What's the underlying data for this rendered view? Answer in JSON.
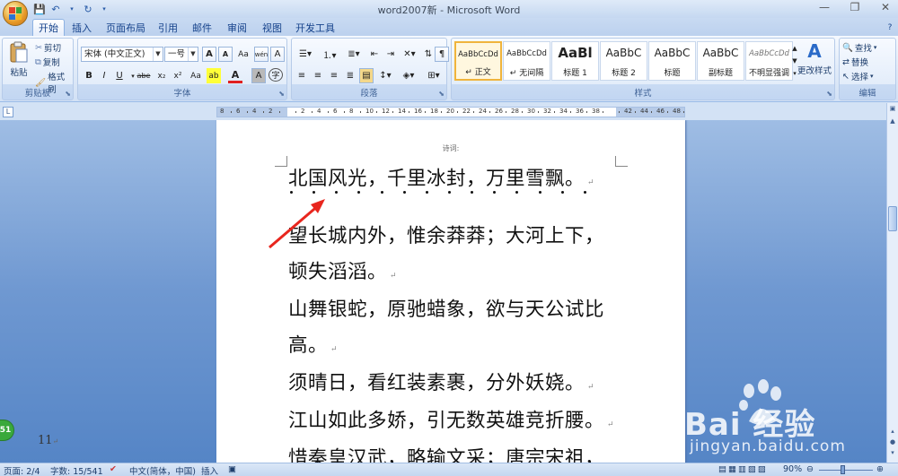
{
  "window": {
    "title": "word2007新 - Microsoft Word"
  },
  "tabs": [
    "开始",
    "插入",
    "页面布局",
    "引用",
    "邮件",
    "审阅",
    "视图",
    "开发工具"
  ],
  "clipboard": {
    "paste": "粘贴",
    "cut": "剪切",
    "copy": "复制",
    "format_painter": "格式刷",
    "label": "剪贴板"
  },
  "font": {
    "name": "宋体 (中文正文)",
    "size": "一号",
    "grow": "A",
    "shrink": "A",
    "clear": "Aa",
    "phonetic": "wén",
    "char_border": "A",
    "bold": "B",
    "italic": "I",
    "underline": "U",
    "strike": "abe",
    "sub": "x₂",
    "sup": "x²",
    "case": "Aa",
    "highlight": "ab",
    "color": "A",
    "shading": "A",
    "encircle": "字",
    "label": "字体"
  },
  "paragraph": {
    "label": "段落"
  },
  "styles": {
    "label": "样式",
    "items": [
      {
        "sample": "AaBbCcDd",
        "name": "↵ 正文"
      },
      {
        "sample": "AaBbCcDd",
        "name": "↵ 无间隔"
      },
      {
        "sample": "AaBl",
        "name": "标题 1"
      },
      {
        "sample": "AaBbC",
        "name": "标题 2"
      },
      {
        "sample": "AaBbC",
        "name": "标题"
      },
      {
        "sample": "AaBbC",
        "name": "副标题"
      },
      {
        "sample": "AaBbCcDd",
        "name": "不明显强调"
      }
    ],
    "change_styles": "更改样式"
  },
  "editing": {
    "find": "查找",
    "replace": "替换",
    "select": "选择",
    "label": "编辑"
  },
  "ruler": {
    "numbers": [
      "8",
      "6",
      "4",
      "2",
      "",
      "2",
      "4",
      "6",
      "8",
      "10",
      "12",
      "14",
      "16",
      "18",
      "20",
      "22",
      "24",
      "26",
      "28",
      "30",
      "32",
      "34",
      "36",
      "38",
      "",
      "42",
      "44",
      "46",
      "48"
    ]
  },
  "document": {
    "header": "诗词:",
    "lines": [
      "北国风光，千里冰封，万里雪飘。",
      "望长城内外，惟余莽莽；大河上下，",
      "顿失滔滔。",
      "山舞银蛇，原驰蜡象，欲与天公试比",
      "高。",
      "须晴日，看红装素裹，分外妖娆。",
      "江山如此多娇，引无数英雄竞折腰。",
      "惜秦皇汉武，略输文采；唐宗宋祖，"
    ],
    "paragraph_mark": "↵",
    "page_number": "11"
  },
  "status": {
    "page": "页面: 2/4",
    "words": "字数: 15/541",
    "lang": "中文(简体，中国)",
    "insert": "插入",
    "zoom": "90%"
  },
  "watermark": {
    "brand": "Bai 经验",
    "url": "jingyan.baidu.com"
  },
  "badge": "51"
}
